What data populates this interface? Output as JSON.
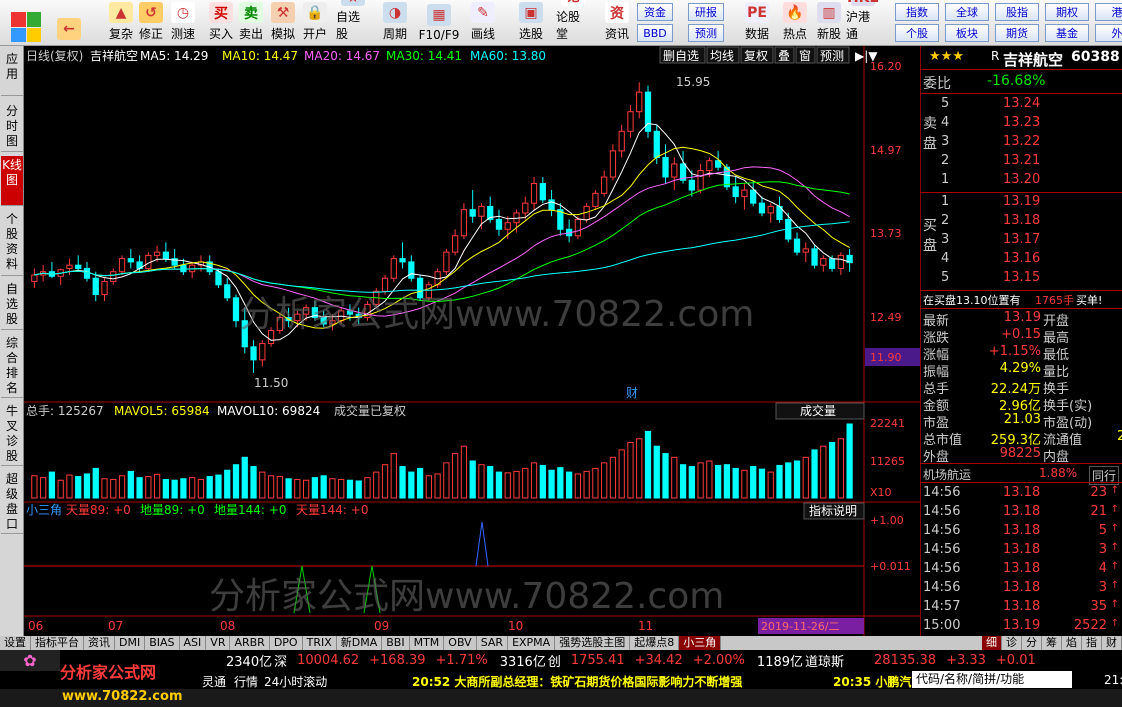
{
  "toolbar": {
    "buttons": [
      {
        "name": "back",
        "label": ""
      },
      {
        "name": "up-down",
        "label": "复杂"
      },
      {
        "name": "fix",
        "label": "修正"
      },
      {
        "name": "speed",
        "label": "测速"
      },
      {
        "name": "buy",
        "label": "买入"
      },
      {
        "name": "sell",
        "label": "卖出"
      },
      {
        "name": "simulate",
        "label": "模拟"
      },
      {
        "name": "open",
        "label": "开户"
      },
      {
        "name": "watchlist",
        "label": "自选股"
      },
      {
        "name": "period",
        "label": "周期"
      },
      {
        "name": "f10",
        "label": "F10/F9"
      },
      {
        "name": "draw",
        "label": "画线"
      },
      {
        "name": "select",
        "label": "选股"
      },
      {
        "name": "forum",
        "label": "论股堂"
      },
      {
        "name": "info",
        "label": "资讯"
      },
      {
        "name": "data",
        "label": "数据"
      },
      {
        "name": "hot",
        "label": "热点"
      },
      {
        "name": "new",
        "label": "新股"
      },
      {
        "name": "hk",
        "label": "沪港通"
      }
    ],
    "icon_glyphs": [
      "←",
      "▲",
      "↺",
      "◷",
      "买",
      "卖",
      "⚒",
      "🔒",
      "★",
      "◑",
      "▦",
      "✎",
      "▣",
      "论",
      "资",
      "PE",
      "🔥",
      "▥",
      "HKE"
    ],
    "grid1": [
      "资金",
      "研报",
      "BBD",
      "预测"
    ],
    "grid2": [
      "指数",
      "全球",
      "股指",
      "期权",
      "港",
      "个股",
      "板块",
      "期货",
      "基金",
      "外"
    ]
  },
  "left_tabs": [
    "应用",
    "分时图",
    "K线图",
    "个股资料",
    "自选股",
    "综合排名",
    "牛叉诊股",
    "超级盘口"
  ],
  "chart": {
    "header": {
      "period": "日线(复权)",
      "name": "吉祥航空",
      "ma5": "MA5: 14.29",
      "ma10": "MA10: 14.47",
      "ma20": "MA20: 14.67",
      "ma30": "MA30: 14.41",
      "ma60": "MA60: 13.80"
    },
    "top_buttons": [
      "删自选",
      "均线",
      "复权",
      "叠",
      "窗",
      "预测"
    ],
    "price_axis": [
      "16.20",
      "14.97",
      "13.73",
      "12.49",
      "11.90"
    ],
    "high_label": "15.95",
    "low_label": "11.50",
    "watermark": "分析家公式网www.70822.com",
    "fin_label": "财",
    "vol_header": {
      "total": "总手: 125267",
      "mavol5": "MAVOL5: 65984",
      "mavol10": "MAVOL10: 69824",
      "note": "成交量已复权"
    },
    "vol_dropdown": "成交量",
    "vol_axis": [
      "22241",
      "11265",
      "X10"
    ],
    "ind_header": {
      "name": "小三角",
      "t89": "天量89: +0",
      "d89": "地量89: +0",
      "d144": "地量144: +0",
      "t144": "天量144: +0"
    },
    "ind_button": "指标说明",
    "ind_axis": [
      "+1.00",
      "+0.011"
    ],
    "dates": [
      "06",
      "07",
      "08",
      "09",
      "10",
      "11"
    ],
    "date_cursor": "2019-11-26/二"
  },
  "chart_data": {
    "type": "candlestick",
    "title": "吉祥航空 日线(复权)",
    "ylim": [
      11.3,
      16.2
    ],
    "ohlc": [
      [
        12.9,
        13.1,
        12.8,
        13.0
      ],
      [
        13.0,
        13.15,
        12.9,
        13.05
      ],
      [
        13.05,
        13.2,
        12.95,
        12.98
      ],
      [
        12.98,
        13.1,
        12.85,
        13.08
      ],
      [
        13.1,
        13.25,
        13.0,
        13.15
      ],
      [
        13.15,
        13.3,
        13.05,
        13.1
      ],
      [
        13.1,
        13.2,
        12.9,
        12.95
      ],
      [
        12.95,
        13.05,
        12.6,
        12.7
      ],
      [
        12.7,
        12.95,
        12.6,
        12.9
      ],
      [
        12.9,
        13.1,
        12.85,
        13.05
      ],
      [
        13.05,
        13.3,
        13.0,
        13.25
      ],
      [
        13.25,
        13.4,
        13.1,
        13.2
      ],
      [
        13.2,
        13.3,
        13.05,
        13.1
      ],
      [
        13.1,
        13.35,
        13.05,
        13.3
      ],
      [
        13.3,
        13.45,
        13.2,
        13.35
      ],
      [
        13.35,
        13.5,
        13.2,
        13.25
      ],
      [
        13.25,
        13.4,
        13.1,
        13.15
      ],
      [
        13.15,
        13.25,
        13.0,
        13.05
      ],
      [
        13.05,
        13.2,
        12.95,
        13.15
      ],
      [
        13.15,
        13.3,
        13.05,
        13.2
      ],
      [
        13.2,
        13.3,
        13.0,
        13.05
      ],
      [
        13.05,
        13.1,
        12.8,
        12.85
      ],
      [
        12.85,
        12.95,
        12.6,
        12.65
      ],
      [
        12.65,
        12.7,
        12.2,
        12.3
      ],
      [
        12.3,
        12.5,
        11.8,
        11.9
      ],
      [
        11.9,
        12.0,
        11.5,
        11.7
      ],
      [
        11.7,
        12.0,
        11.6,
        11.95
      ],
      [
        11.95,
        12.2,
        11.9,
        12.15
      ],
      [
        12.15,
        12.4,
        12.1,
        12.35
      ],
      [
        12.35,
        12.5,
        12.2,
        12.3
      ],
      [
        12.3,
        12.45,
        12.2,
        12.4
      ],
      [
        12.4,
        12.55,
        12.3,
        12.5
      ],
      [
        12.5,
        12.6,
        12.3,
        12.35
      ],
      [
        12.35,
        12.45,
        12.2,
        12.25
      ],
      [
        12.25,
        12.4,
        12.15,
        12.3
      ],
      [
        12.3,
        12.5,
        12.25,
        12.45
      ],
      [
        12.45,
        12.55,
        12.3,
        12.4
      ],
      [
        12.4,
        12.5,
        12.25,
        12.35
      ],
      [
        12.35,
        12.6,
        12.3,
        12.55
      ],
      [
        12.55,
        12.8,
        12.5,
        12.75
      ],
      [
        12.75,
        13.0,
        12.7,
        12.95
      ],
      [
        12.95,
        13.3,
        12.9,
        13.25
      ],
      [
        13.25,
        13.5,
        13.1,
        13.2
      ],
      [
        13.2,
        13.3,
        12.9,
        12.95
      ],
      [
        12.95,
        13.0,
        12.6,
        12.65
      ],
      [
        12.65,
        12.9,
        12.6,
        12.85
      ],
      [
        12.85,
        13.1,
        12.8,
        13.05
      ],
      [
        13.05,
        13.4,
        13.0,
        13.35
      ],
      [
        13.35,
        13.7,
        13.3,
        13.6
      ],
      [
        13.6,
        14.1,
        13.55,
        14.0
      ],
      [
        14.0,
        14.3,
        13.8,
        13.9
      ],
      [
        13.9,
        14.1,
        13.7,
        14.05
      ],
      [
        14.05,
        14.2,
        13.8,
        13.85
      ],
      [
        13.85,
        14.0,
        13.6,
        13.7
      ],
      [
        13.7,
        13.9,
        13.55,
        13.8
      ],
      [
        13.8,
        14.0,
        13.65,
        13.95
      ],
      [
        13.95,
        14.2,
        13.85,
        14.1
      ],
      [
        14.1,
        14.5,
        14.0,
        14.4
      ],
      [
        14.4,
        14.5,
        14.1,
        14.15
      ],
      [
        14.15,
        14.3,
        13.9,
        14.0
      ],
      [
        14.0,
        14.1,
        13.6,
        13.7
      ],
      [
        13.7,
        13.85,
        13.5,
        13.6
      ],
      [
        13.6,
        13.9,
        13.55,
        13.85
      ],
      [
        13.85,
        14.1,
        13.8,
        14.05
      ],
      [
        14.05,
        14.3,
        14.0,
        14.25
      ],
      [
        14.25,
        14.6,
        14.2,
        14.5
      ],
      [
        14.5,
        15.0,
        14.45,
        14.9
      ],
      [
        14.9,
        15.3,
        14.8,
        15.2
      ],
      [
        15.2,
        15.6,
        15.1,
        15.5
      ],
      [
        15.5,
        15.95,
        15.4,
        15.8
      ],
      [
        15.8,
        15.9,
        15.1,
        15.2
      ],
      [
        15.2,
        15.3,
        14.7,
        14.8
      ],
      [
        14.8,
        15.0,
        14.4,
        14.5
      ],
      [
        14.5,
        14.8,
        14.3,
        14.7
      ],
      [
        14.7,
        14.9,
        14.4,
        14.45
      ],
      [
        14.45,
        14.6,
        14.2,
        14.3
      ],
      [
        14.3,
        14.7,
        14.25,
        14.6
      ],
      [
        14.6,
        14.8,
        14.5,
        14.75
      ],
      [
        14.75,
        14.9,
        14.6,
        14.65
      ],
      [
        14.65,
        14.7,
        14.3,
        14.35
      ],
      [
        14.35,
        14.5,
        14.1,
        14.2
      ],
      [
        14.2,
        14.4,
        14.0,
        14.3
      ],
      [
        14.3,
        14.45,
        14.05,
        14.1
      ],
      [
        14.1,
        14.2,
        13.9,
        13.95
      ],
      [
        13.95,
        14.1,
        13.8,
        14.05
      ],
      [
        14.05,
        14.2,
        13.8,
        13.85
      ],
      [
        13.85,
        13.95,
        13.5,
        13.55
      ],
      [
        13.55,
        13.65,
        13.3,
        13.35
      ],
      [
        13.35,
        13.5,
        13.2,
        13.4
      ],
      [
        13.4,
        13.45,
        13.1,
        13.15
      ],
      [
        13.15,
        13.3,
        13.05,
        13.25
      ],
      [
        13.25,
        13.3,
        13.05,
        13.1
      ],
      [
        13.1,
        13.35,
        13.0,
        13.3
      ],
      [
        13.3,
        13.4,
        13.05,
        13.19
      ]
    ],
    "volume": [
      60,
      55,
      70,
      48,
      62,
      58,
      65,
      80,
      52,
      50,
      60,
      72,
      55,
      58,
      64,
      50,
      48,
      52,
      55,
      50,
      58,
      62,
      75,
      90,
      110,
      85,
      70,
      60,
      58,
      52,
      50,
      48,
      55,
      60,
      52,
      50,
      48,
      46,
      55,
      70,
      90,
      120,
      85,
      70,
      80,
      60,
      65,
      95,
      120,
      140,
      100,
      90,
      85,
      70,
      68,
      72,
      80,
      95,
      88,
      75,
      82,
      70,
      65,
      72,
      80,
      95,
      110,
      130,
      150,
      160,
      180,
      140,
      120,
      110,
      90,
      85,
      95,
      100,
      88,
      90,
      80,
      75,
      85,
      78,
      70,
      88,
      95,
      100,
      110,
      130,
      140,
      150,
      160,
      200
    ],
    "xlabels": [
      "06",
      "07",
      "08",
      "09",
      "10",
      "11"
    ]
  },
  "quote": {
    "stars": "★★★",
    "code_prefix": "R",
    "name": "吉祥航空",
    "code": "60388",
    "webi_label": "委比",
    "webi": "-16.68%",
    "sell_label": "卖盘",
    "buy_label": "买盘",
    "asks": [
      {
        "n": "5",
        "p": "13.24"
      },
      {
        "n": "4",
        "p": "13.23"
      },
      {
        "n": "3",
        "p": "13.22"
      },
      {
        "n": "2",
        "p": "13.21"
      },
      {
        "n": "1",
        "p": "13.20"
      }
    ],
    "bids": [
      {
        "n": "1",
        "p": "13.19"
      },
      {
        "n": "2",
        "p": "13.18"
      },
      {
        "n": "3",
        "p": "13.17"
      },
      {
        "n": "4",
        "p": "13.16"
      },
      {
        "n": "5",
        "p": "13.15"
      }
    ],
    "queue": {
      "left": "在买盘13.10位置有",
      "mid": "1765手",
      "right": "买单!"
    },
    "stats": [
      {
        "l": "最新",
        "v": "13.19",
        "l2": "开盘",
        "v2": ""
      },
      {
        "l": "涨跌",
        "v": "+0.15",
        "l2": "最高",
        "v2": ""
      },
      {
        "l": "涨幅",
        "v": "+1.15%",
        "l2": "最低",
        "v2": ""
      },
      {
        "l": "振幅",
        "v": "4.29%",
        "l2": "量比",
        "v2": ""
      },
      {
        "l": "总手",
        "v": "22.24万",
        "l2": "换手",
        "v2": ""
      },
      {
        "l": "金额",
        "v": "2.96亿",
        "l2": "换手(实)",
        "v2": ""
      },
      {
        "l": "市盈",
        "v": "21.03",
        "l2": "市盈(动)",
        "v2": ""
      },
      {
        "l": "总市值",
        "v": "259.3亿",
        "l2": "流通值",
        "v2": "2"
      },
      {
        "l": "外盘",
        "v": "98225",
        "l2": "内盘",
        "v2": ""
      }
    ],
    "sector": {
      "name": "机场航运",
      "pct": "1.88%",
      "btn": "同行"
    },
    "ticks": [
      {
        "t": "14:56",
        "p": "13.18",
        "v": "23"
      },
      {
        "t": "14:56",
        "p": "13.18",
        "v": "21"
      },
      {
        "t": "14:56",
        "p": "13.18",
        "v": "5"
      },
      {
        "t": "14:56",
        "p": "13.18",
        "v": "3"
      },
      {
        "t": "14:56",
        "p": "13.18",
        "v": "4"
      },
      {
        "t": "14:56",
        "p": "13.18",
        "v": "3"
      },
      {
        "t": "14:57",
        "p": "13.18",
        "v": "35"
      },
      {
        "t": "15:00",
        "p": "13.19",
        "v": "2522"
      }
    ],
    "tabs": [
      "细",
      "诊",
      "分",
      "筹",
      "焰",
      "指",
      "财"
    ]
  },
  "bottom_tabs": [
    "设置",
    "指标平台",
    "资讯",
    "DMI",
    "BIAS",
    "ASI",
    "VR",
    "ARBR",
    "DPO",
    "TRIX",
    "新DMA",
    "BBI",
    "MTM",
    "OBV",
    "SAR",
    "EXPMA",
    "强势选股主图",
    "起爆点8",
    "小三角"
  ],
  "ticker": [
    "2340亿",
    "深",
    "10004.62",
    "+168.39",
    "+1.71%",
    "3316亿",
    "创",
    "1755.41",
    "+34.42",
    "+2.00%",
    "1189亿",
    "道琼斯",
    "28135.38",
    "+3.33",
    "+0.01"
  ],
  "news": {
    "a": "灵通",
    "b": "行情",
    "c": "24小时滚动",
    "d": "20:52 大商所副总经理：铁矿石期货价格国际影响力不断增强",
    "e": "20:35 小鹏汽",
    "search": "代码/名称/简拼/功能",
    "time": "21:"
  },
  "footer": {
    "logo": "分析家公式网",
    "url": "www.70822.com"
  }
}
